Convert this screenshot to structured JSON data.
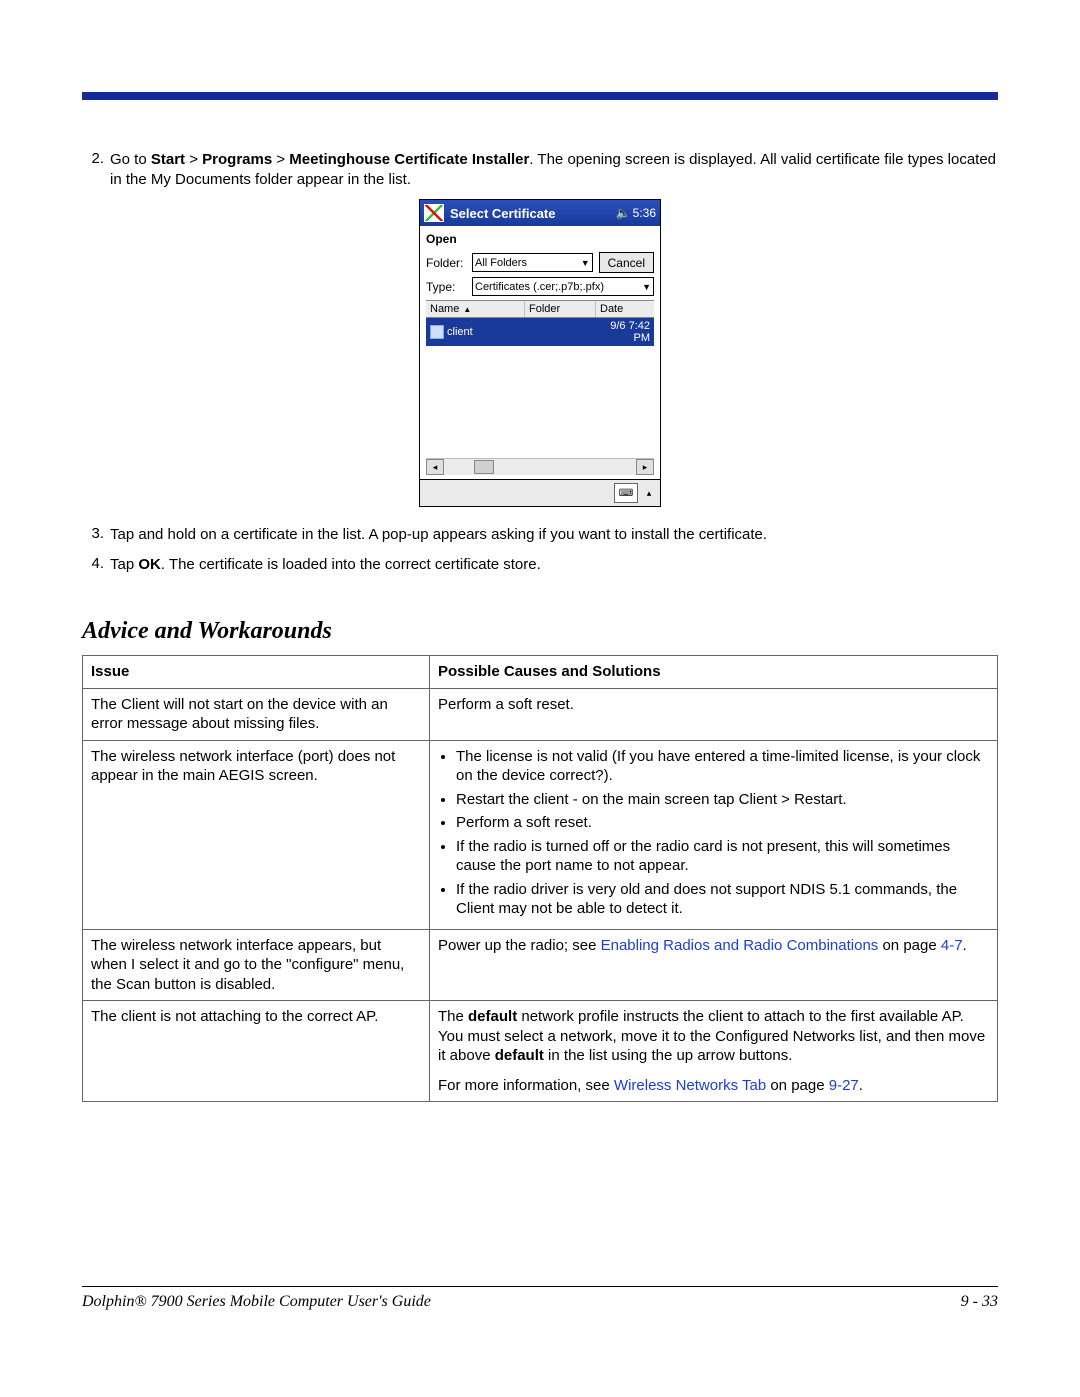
{
  "steps": {
    "s2": {
      "num": "2.",
      "pre": "Go to ",
      "path_start": "Start",
      "sep1": " > ",
      "path_programs": "Programs",
      "sep2": " > ",
      "path_installer": "Meetinghouse Certificate Installer",
      "post": ". The opening screen is displayed. All valid certificate file types located in the My Documents folder appear in the list."
    },
    "s3": {
      "num": "3.",
      "text": "Tap and hold on a certificate in the list. A pop-up appears asking if you want to install the certificate."
    },
    "s4": {
      "num": "4.",
      "pre": "Tap ",
      "bold": "OK",
      "post": ". The certificate is loaded into the correct certificate store."
    }
  },
  "dialog": {
    "title": "Select Certificate",
    "time": "5:36",
    "open_label": "Open",
    "folder_label": "Folder:",
    "folder_value": "All Folders",
    "type_label": "Type:",
    "type_value": "Certificates (.cer;.p7b;.pfx)",
    "cancel": "Cancel",
    "col_name": "Name",
    "col_folder": "Folder",
    "col_date": "Date",
    "row_name": "client",
    "row_date": "9/6 7:42 PM"
  },
  "section_heading": "Advice and Workarounds",
  "table": {
    "h_issue": "Issue",
    "h_sol": "Possible Causes and Solutions",
    "rows": {
      "r1": {
        "issue": "The Client will not start on the device with an error message about missing files.",
        "sol": "Perform a soft reset."
      },
      "r2": {
        "issue": "The wireless network interface (port) does not appear in the main AEGIS screen.",
        "bullets": {
          "b1": "The license is not valid (If you have entered a time-limited license, is your clock on the device correct?).",
          "b2": "Restart the client - on the main screen tap Client > Restart.",
          "b3": "Perform a soft reset.",
          "b4": "If the radio is turned off or the radio card is not present, this will sometimes cause the port name to not appear.",
          "b5": "If the radio driver is very old and does not support NDIS 5.1 commands, the Client may not be able to detect it."
        }
      },
      "r3": {
        "issue": "The wireless network interface appears, but when I select it and go to the \"configure\" menu, the Scan button is disabled.",
        "sol_pre": "Power up the radio; see ",
        "sol_link": "Enabling Radios and Radio Combinations",
        "sol_mid": " on page ",
        "sol_page": "4-7",
        "sol_post": "."
      },
      "r4": {
        "issue": "The client is not attaching to the correct AP.",
        "p1_pre": "The ",
        "p1_b1": "default",
        "p1_mid": " network profile instructs the client to attach to the first available AP. You must select a network, move it to the Configured Networks list, and then move it above ",
        "p1_b2": "default",
        "p1_post": " in the list using the up arrow buttons.",
        "p2_pre": "For more information, see ",
        "p2_link": "Wireless Networks Tab",
        "p2_mid": " on page ",
        "p2_page": "9-27",
        "p2_post": "."
      }
    }
  },
  "footer": {
    "left": "Dolphin® 7900 Series Mobile Computer User's Guide",
    "right": "9 - 33"
  }
}
